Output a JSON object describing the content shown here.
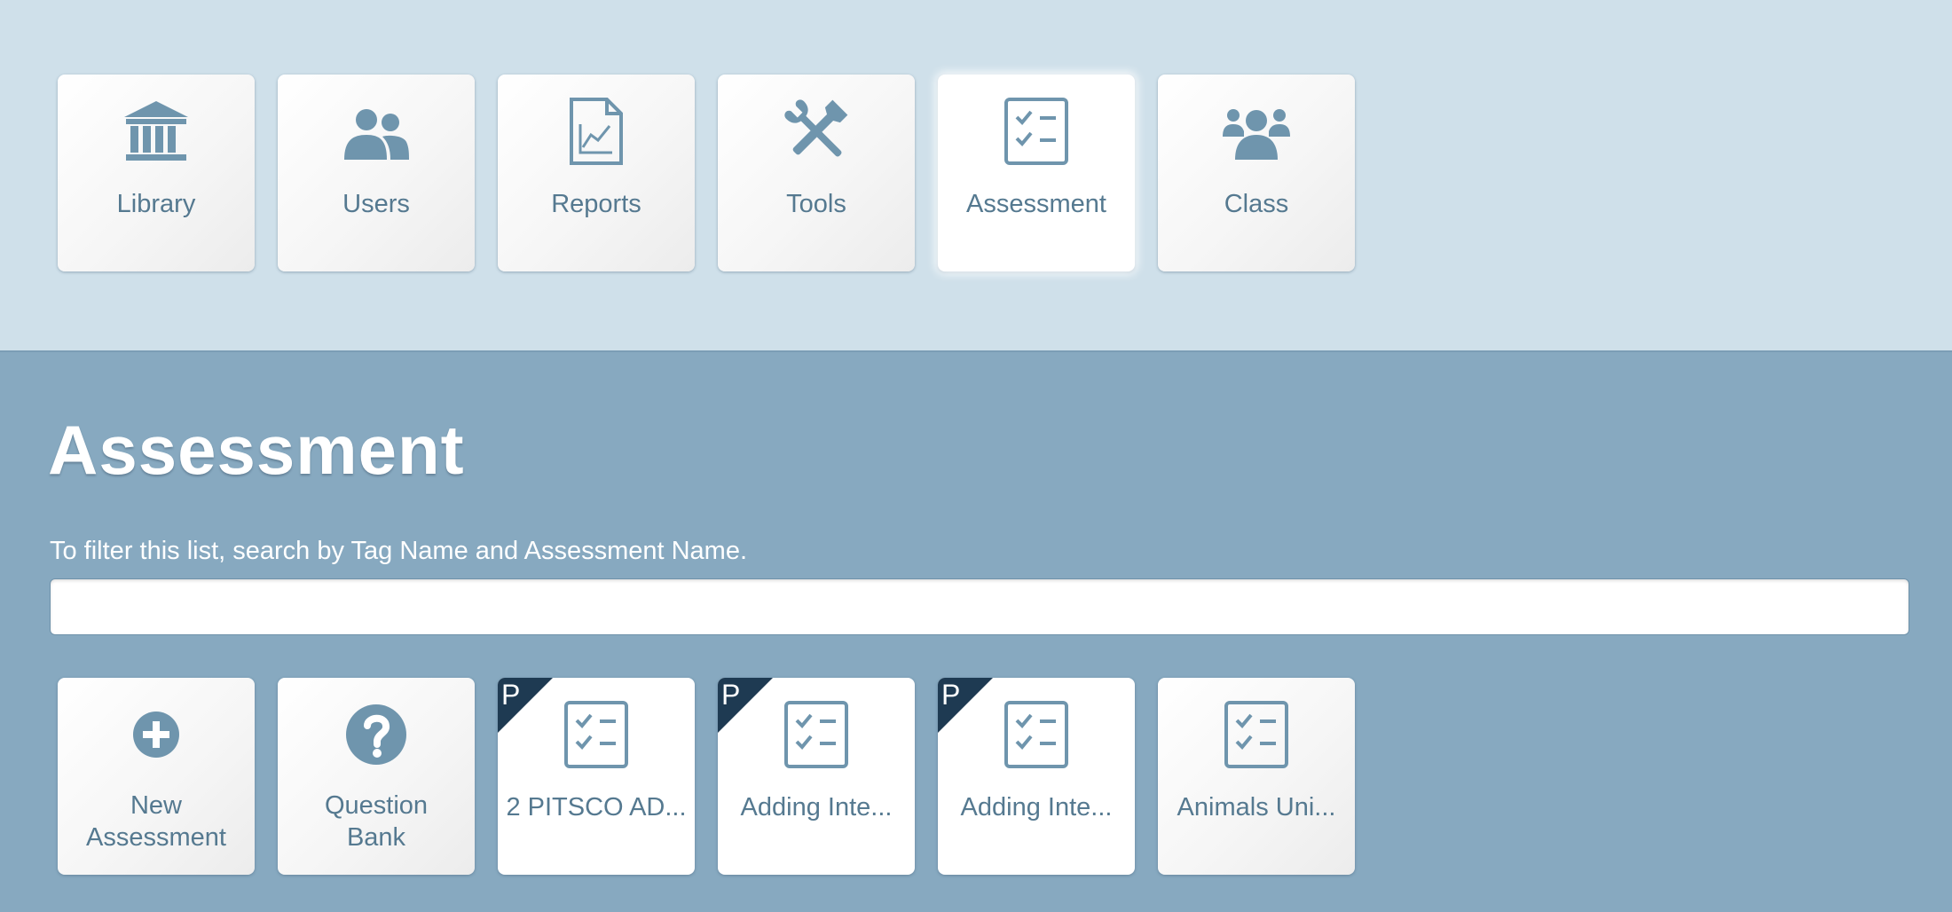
{
  "nav": {
    "tiles": [
      {
        "label": "Library",
        "icon": "library-icon"
      },
      {
        "label": "Users",
        "icon": "users-icon"
      },
      {
        "label": "Reports",
        "icon": "reports-icon"
      },
      {
        "label": "Tools",
        "icon": "tools-icon"
      },
      {
        "label": "Assessment",
        "icon": "assessment-icon",
        "selected": true
      },
      {
        "label": "Class",
        "icon": "class-icon"
      }
    ]
  },
  "main": {
    "title": "Assessment",
    "filter_hint": "To filter this list, search by Tag Name and Assessment Name.",
    "search": {
      "value": "",
      "placeholder": ""
    },
    "items": [
      {
        "label_line1": "New",
        "label_line2": "Assessment",
        "icon": "plus-circle-icon"
      },
      {
        "label_line1": "Question",
        "label_line2": "Bank",
        "icon": "question-circle-icon"
      },
      {
        "label": "2 PITSCO AD...",
        "icon": "checklist-icon",
        "badge": "P"
      },
      {
        "label": "Adding Inte...",
        "icon": "checklist-icon",
        "badge": "P"
      },
      {
        "label": "Adding Inte...",
        "icon": "checklist-icon",
        "badge": "P"
      },
      {
        "label": "Animals Uni...",
        "icon": "checklist-icon"
      }
    ]
  },
  "colors": {
    "top_background": "#cfe0ea",
    "main_background": "#87a9c0",
    "icon": "#6f95ad",
    "label": "#557990",
    "badge": "#1e3a52"
  }
}
